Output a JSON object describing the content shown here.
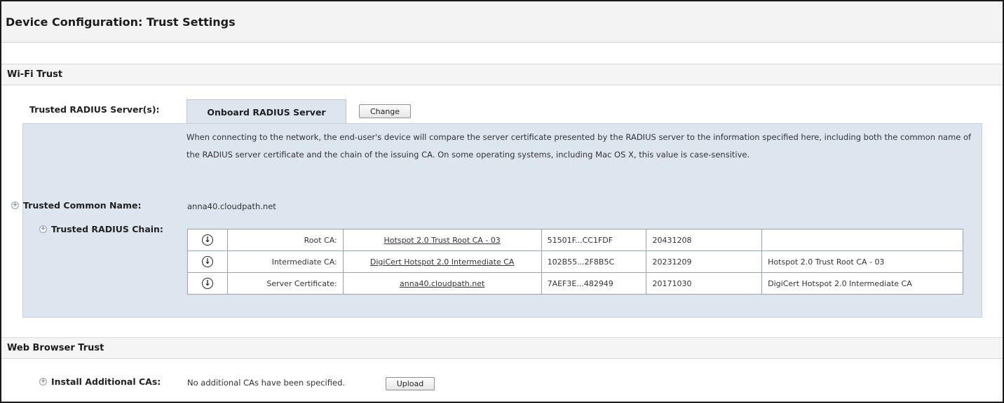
{
  "page": {
    "title": "Device Configuration: Trust Settings"
  },
  "wifi_trust": {
    "heading": "Wi-Fi Trust",
    "trusted_radius_label": "Trusted RADIUS Server(s):",
    "selected_tab": "Onboard RADIUS Server",
    "change_button": "Change",
    "description": "When connecting to the network, the end-user's device will compare the server certificate presented by the RADIUS server to the information specified here, including both the common name of the RADIUS server certificate and the chain of the issuing CA. On some operating systems, including Mac OS X, this value is case-sensitive.",
    "common_name_label": "Trusted Common Name:",
    "common_name_value": "anna40.cloudpath.net",
    "chain_label": "Trusted RADIUS Chain:",
    "chain": [
      {
        "label": "Root CA:",
        "name": "Hotspot 2.0 Trust Root CA - 03",
        "thumbprint": "51501F...CC1FDF",
        "expires": "20431208",
        "issuer": ""
      },
      {
        "label": "Intermediate CA:",
        "name": "DigiCert Hotspot 2.0 Intermediate CA",
        "thumbprint": "102B55...2F8B5C",
        "expires": "20231209",
        "issuer": "Hotspot 2.0 Trust Root CA - 03"
      },
      {
        "label": "Server Certificate:",
        "name": "anna40.cloudpath.net",
        "thumbprint": "7AEF3E...482949",
        "expires": "20171030",
        "issuer": "DigiCert Hotspot 2.0 Intermediate CA"
      }
    ]
  },
  "web_browser_trust": {
    "heading": "Web Browser Trust",
    "install_label": "Install Additional CAs:",
    "install_value": "No additional CAs have been specified.",
    "upload_button": "Upload"
  },
  "icons": {
    "expand": "plus-circle-icon",
    "download": "download-circle-icon"
  }
}
